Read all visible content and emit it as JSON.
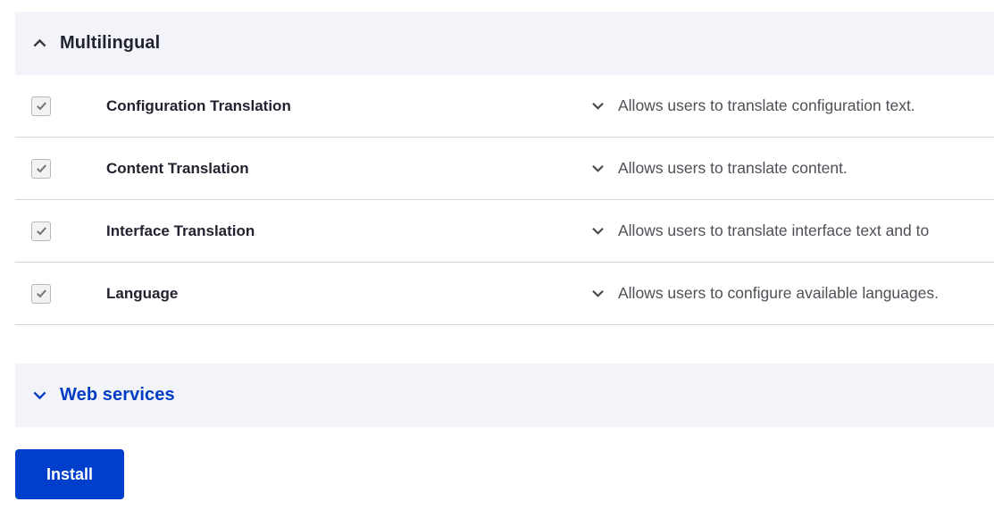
{
  "colors": {
    "header-bg": "#f3f4f9",
    "heading": "#222330",
    "link": "#003cc5",
    "button": "#003ecc",
    "desc": "#4f5057",
    "sep": "#d6d6da",
    "cb-bg": "#f2f2f3",
    "cb-border": "#b7b7bd",
    "cb-check": "#73737b"
  },
  "sections": [
    {
      "title": "Multilingual",
      "state": "expanded",
      "toggle_icon": "chevron-up-icon",
      "modules": [
        {
          "name": "Configuration Translation",
          "checked": true,
          "disabled": true,
          "description": "Allows users to translate configuration text.",
          "description_toggle_icon": "chevron-down-icon"
        },
        {
          "name": "Content Translation",
          "checked": true,
          "disabled": true,
          "description": "Allows users to translate content.",
          "description_toggle_icon": "chevron-down-icon"
        },
        {
          "name": "Interface Translation",
          "checked": true,
          "disabled": true,
          "description": "Allows users to translate interface text and to",
          "description_toggle_icon": "chevron-down-icon"
        },
        {
          "name": "Language",
          "checked": true,
          "disabled": true,
          "description": "Allows users to configure available languages.",
          "description_toggle_icon": "chevron-down-icon"
        }
      ]
    },
    {
      "title": "Web services",
      "state": "collapsed",
      "toggle_icon": "chevron-down-icon",
      "modules": []
    }
  ],
  "install_button": {
    "label": "Install"
  }
}
